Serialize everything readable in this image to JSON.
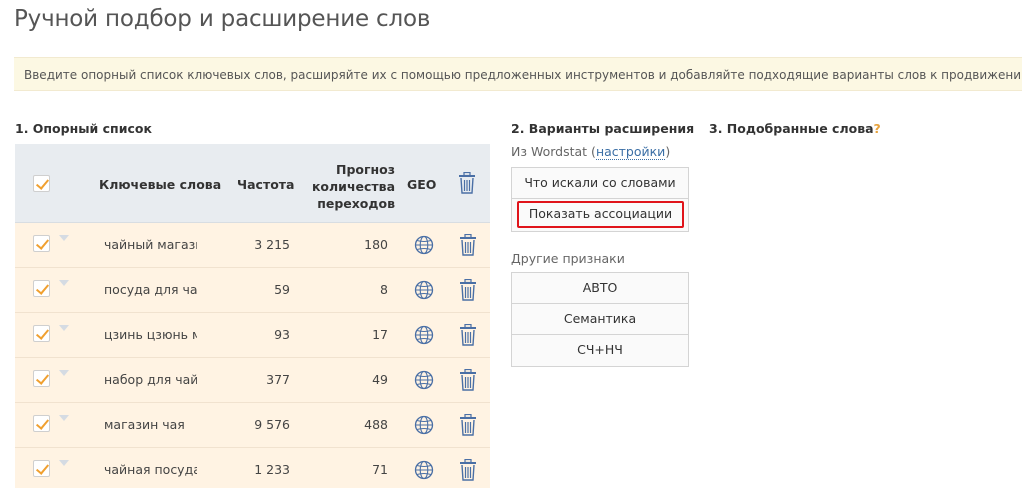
{
  "page": {
    "title": "Ручной подбор и расширение слов",
    "hint": "Введите опорный список ключевых слов, расширяйте их с помощью предложенных инструментов и добавляйте подходящие варианты слов к продвижению"
  },
  "sections": {
    "base_list": "1. Опорный список",
    "expansion": "2. Варианты расширения",
    "selected": "3. Подобранные слова",
    "help_mark": "?"
  },
  "table": {
    "headers": {
      "keywords": "Ключевые слова",
      "frequency": "Частота",
      "forecast_line1": "Прогноз",
      "forecast_line2": "количества",
      "forecast_line3": "переходов",
      "geo": "GEO"
    },
    "rows": [
      {
        "keyword": "чайный магазин",
        "frequency": "3 215",
        "forecast": "180"
      },
      {
        "keyword": "посуда для чайной",
        "frequency": "59",
        "forecast": "8"
      },
      {
        "keyword": "цзинь цзюнь мэй",
        "frequency": "93",
        "forecast": "17"
      },
      {
        "keyword": "набор для чайной",
        "frequency": "377",
        "forecast": "49"
      },
      {
        "keyword": "магазин чая",
        "frequency": "9 576",
        "forecast": "488"
      },
      {
        "keyword": "чайная посуда",
        "frequency": "1 233",
        "forecast": "71"
      }
    ]
  },
  "expansion": {
    "source_prefix": "Из Wordstat (",
    "source_link": "настройки",
    "source_suffix": ")",
    "wordstat_buttons": [
      "Что искали со словами",
      "Показать ассоциации"
    ],
    "other_label": "Другие признаки",
    "other_buttons": [
      "АВТО",
      "Семантика",
      "СЧ+НЧ"
    ]
  },
  "colors": {
    "accent_check": "#f0a030",
    "highlight": "#e0141a",
    "row_bg": "#fff3e3",
    "header_bg": "#e8ecf0",
    "icon_blue": "#4a6fa5"
  }
}
